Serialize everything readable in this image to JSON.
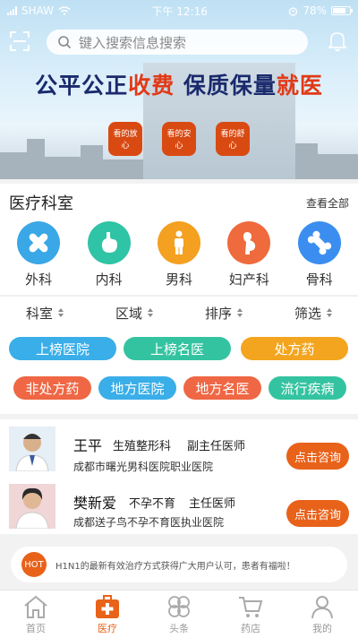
{
  "status_bar": {
    "carrier": "SHAW",
    "time": "下午 12:16",
    "battery": "78%"
  },
  "search": {
    "placeholder": "键入搜索信息搜索"
  },
  "banner": {
    "slogan_part1": "公平公正",
    "slogan_part2": "收费",
    "slogan_part3": " 保质保量",
    "slogan_part4": "就医",
    "tags": [
      "看的放心",
      "看的安心",
      "看的舒心"
    ]
  },
  "departments": {
    "title": "医疗科室",
    "view_all": "查看全部",
    "items": [
      {
        "label": "外科",
        "icon": "bandage-icon",
        "color": "#3aa7e6"
      },
      {
        "label": "内科",
        "icon": "stomach-icon",
        "color": "#2ec4a5"
      },
      {
        "label": "男科",
        "icon": "male-figure-icon",
        "color": "#f4a020"
      },
      {
        "label": "妇产科",
        "icon": "pregnant-woman-icon",
        "color": "#ef6a3c"
      },
      {
        "label": "骨科",
        "icon": "bone-icon",
        "color": "#3b8ef0"
      }
    ]
  },
  "filters": [
    "科室",
    "区域",
    "排序",
    "筛选"
  ],
  "categories": [
    {
      "label": "上榜医院",
      "color": "#3aaee8"
    },
    {
      "label": "上榜名医",
      "color": "#34c3a0"
    },
    {
      "label": "处方药",
      "color": "#f3a51f"
    },
    {
      "label": "非处方药",
      "color": "#ef6744"
    },
    {
      "label": "地方医院",
      "color": "#3aaee8"
    },
    {
      "label": "地方名医",
      "color": "#ef6744"
    },
    {
      "label": "流行疾病",
      "color": "#34c3a0"
    }
  ],
  "doctors": [
    {
      "name": "王平",
      "dept": "生殖整形科",
      "rank": "副主任医师",
      "hospital": "成都市曙光男科医院职业医院",
      "button": "点击咨询"
    },
    {
      "name": "樊新爱",
      "dept": "不孕不育",
      "rank": "主任医师",
      "hospital": "成都送子鸟不孕不育医执业医院",
      "button": "点击咨询"
    }
  ],
  "hot": {
    "badge": "HOT",
    "text": "H1N1的最新有效治疗方式获得广大用户认可，患者有福啦！"
  },
  "tabbar": [
    {
      "label": "首页",
      "icon": "home-icon"
    },
    {
      "label": "医疗",
      "icon": "medical-kit-icon"
    },
    {
      "label": "头条",
      "icon": "clover-icon"
    },
    {
      "label": "药店",
      "icon": "cart-icon"
    },
    {
      "label": "我的",
      "icon": "user-icon"
    }
  ],
  "colors": {
    "accent": "#e8621a",
    "slogan_blue": "#1a2a6c",
    "slogan_red": "#e13a17"
  }
}
